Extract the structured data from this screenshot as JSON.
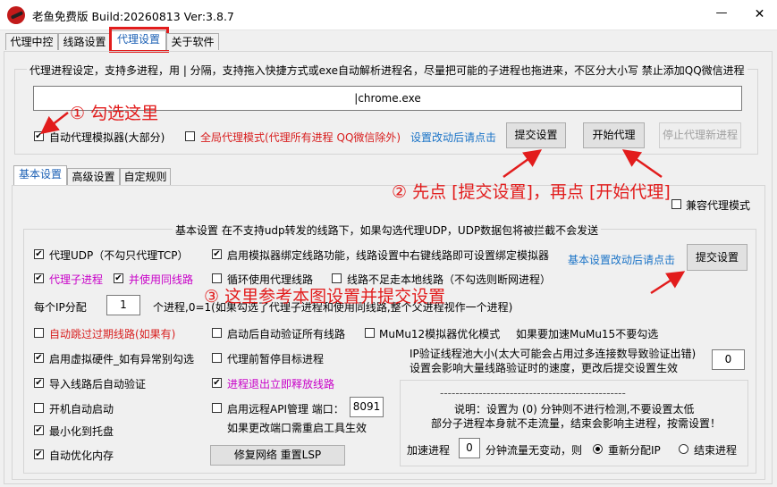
{
  "window": {
    "title": "老鱼免费版 Build:20260813 Ver:3.8.7",
    "minimize_glyph": "—",
    "close_glyph": "✕"
  },
  "main_tabs": [
    "代理中控",
    "线路设置",
    "代理设置",
    "关于软件"
  ],
  "proxy_process": {
    "group_label": "代理进程设定，支持多进程，用 | 分隔，支持拖入快捷方式或exe自动解析进程名，尽量把可能的子进程也拖进来，不区分大小写 禁止添加QQ微信进程",
    "process_value": "|chrome.exe",
    "auto_proxy_emulator": "自动代理模拟器(大部分)",
    "global_mode": "全局代理模式(代理所有进程 QQ微信除外)",
    "change_note": "设置改动后请点击",
    "submit_btn": "提交设置",
    "start_btn": "开始代理",
    "stop_btn": "停止代理新进程"
  },
  "sub_tabs": [
    "基本设置",
    "高级设置",
    "自定规则"
  ],
  "compat_mode": "兼容代理模式",
  "basic": {
    "group_label": "基本设置  在不支持udp转发的线路下，如果勾选代理UDP，UDP数据包将被拦截不会发送",
    "proxy_udp": "代理UDP（不勾只代理TCP）",
    "emu_bind": "启用模拟器绑定线路功能，线路设置中右键线路即可设置绑定模拟器",
    "change_note": "基本设置改动后请点击",
    "submit_btn": "提交设置",
    "proxy_child": "代理子进程",
    "same_line": "并使用同线路",
    "loop_lines": "循环使用代理线路",
    "insufficient_local": "线路不足走本地线路（不勾选则断网进程）",
    "per_ip_label": "每个IP分配",
    "per_ip_value": "1",
    "per_ip_suffix": "个进程,0=1(如果勾选了代理子进程和使用同线路,整个父进程视作一个进程)",
    "auto_skip_expired": "自动跳过过期线路(如果有)",
    "verify_on_start": "启动后自动验证所有线路",
    "mumu12": "MuMu12模拟器优化模式",
    "mumu15_note": "如果要加速MuMu15不要勾选",
    "ip_pool_label": "IP验证线程池大小(太大可能会占用过多连接数导致验证出错)",
    "ip_pool_note": "设置会影响大量线路验证时的速度，更改后提交设置生效",
    "ip_pool_value": "0",
    "virtual_hw": "启用虚拟硬件_如有异常别勾选",
    "pause_target": "代理前暂停目标进程",
    "import_verify": "导入线路后自动验证",
    "release_on_exit": "进程退出立即释放线路",
    "autostart": "开机自动启动",
    "remote_api": "启用远程API管理 端口：",
    "api_port": "8091",
    "restart_note": "如果更改端口需重启工具生效",
    "minimize_tray": "最小化到托盘",
    "optimize_mem": "自动优化内存",
    "repair_btn": "修复网络 重置LSP",
    "dashes": "------------------------------------------------",
    "explain1": "说明：设置为 (0) 分钟则不进行检测,不要设置太低",
    "explain2": "部分子进程本身就不走流量，结束会影响主进程，按需设置！",
    "speedup_label": "加速进程",
    "speedup_value": "0",
    "speedup_suffix": "分钟流量无变动，则",
    "realloc_ip": "重新分配IP",
    "end_process": "结束进程"
  },
  "annotations": {
    "step1": "① 勾选这里",
    "step2": "② 先点 [提交设置]，再点 [开始代理]",
    "step3": "③ 这里参考本图设置并提交设置"
  }
}
